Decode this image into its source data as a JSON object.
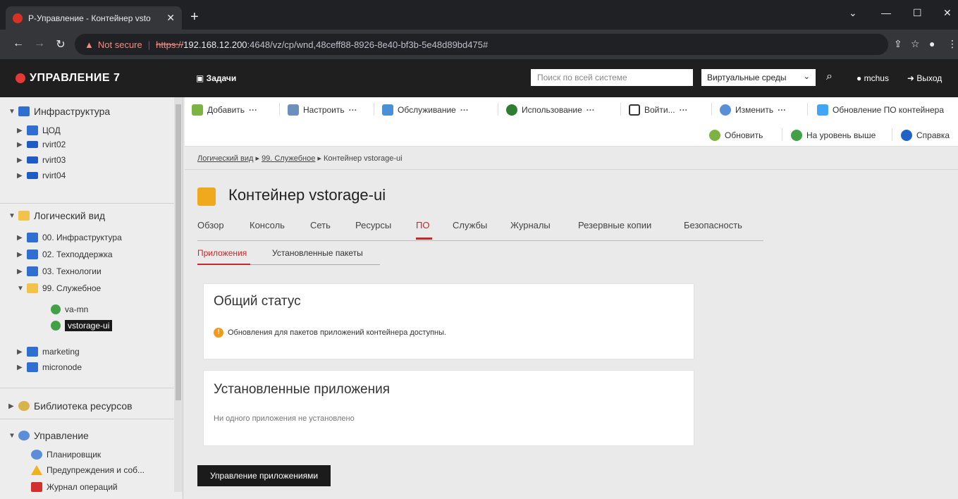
{
  "browser": {
    "tab_title": "Р-Управление - Контейнер vsto",
    "new_tab": "+",
    "url_warning": "Not secure",
    "url_scheme": "https://",
    "url_host": "192.168.12.200",
    "url_rest": ":4648/vz/cp/wnd,48ceff88-8926-8e40-bf3b-5e48d89bd475#"
  },
  "header": {
    "brand": "УПРАВЛЕНИЕ 7",
    "tasks": "Задачи",
    "search_placeholder": "Поиск по всей системе",
    "env_select": "Виртуальные среды",
    "user": "mchus",
    "logout": "Выход"
  },
  "sidebar": {
    "infrastructure": {
      "label": "Инфраструктура",
      "items": [
        "ЦОД",
        "rvirt02",
        "rvirt03",
        "rvirt04"
      ]
    },
    "logical": {
      "label": "Логический вид",
      "items": [
        "00. Инфраструктура",
        "02. Техподдержка",
        "03. Технологии",
        "99. Служебное"
      ],
      "service_children": [
        "va-mn",
        "vstorage-ui"
      ],
      "more": [
        "marketing",
        "micronode"
      ]
    },
    "library": "Библиотека ресурсов",
    "management": {
      "label": "Управление",
      "items": [
        "Планировщик",
        "Предупреждения и соб...",
        "Журнал операций"
      ]
    }
  },
  "toolbar": {
    "add": "Добавить",
    "configure": "Настроить",
    "service": "Обслуживание",
    "usage": "Использование",
    "login": "Войти...",
    "change": "Изменить",
    "update_sw": "Обновление ПО контейнера",
    "refresh": "Обновить",
    "level_up": "На уровень выше",
    "help": "Справка",
    "dots": "···"
  },
  "breadcrumb": {
    "items": [
      "Логический вид",
      "99. Служебное",
      "Контейнер vstorage-ui"
    ],
    "sep": "▸"
  },
  "page": {
    "title": "Контейнер vstorage-ui",
    "tabs": [
      "Обзор",
      "Консоль",
      "Сеть",
      "Ресурсы",
      "ПО",
      "Службы",
      "Журналы",
      "Резервные копии",
      "Безопасность"
    ],
    "subtabs": [
      "Приложения",
      "Установленные пакеты"
    ]
  },
  "status_card": {
    "title": "Общий статус",
    "message": "Обновления для пакетов приложений контейнера доступны."
  },
  "installed_card": {
    "title": "Установленные приложения",
    "empty": "Ни одного приложения не установлено"
  },
  "manage_button": "Управление приложениями"
}
